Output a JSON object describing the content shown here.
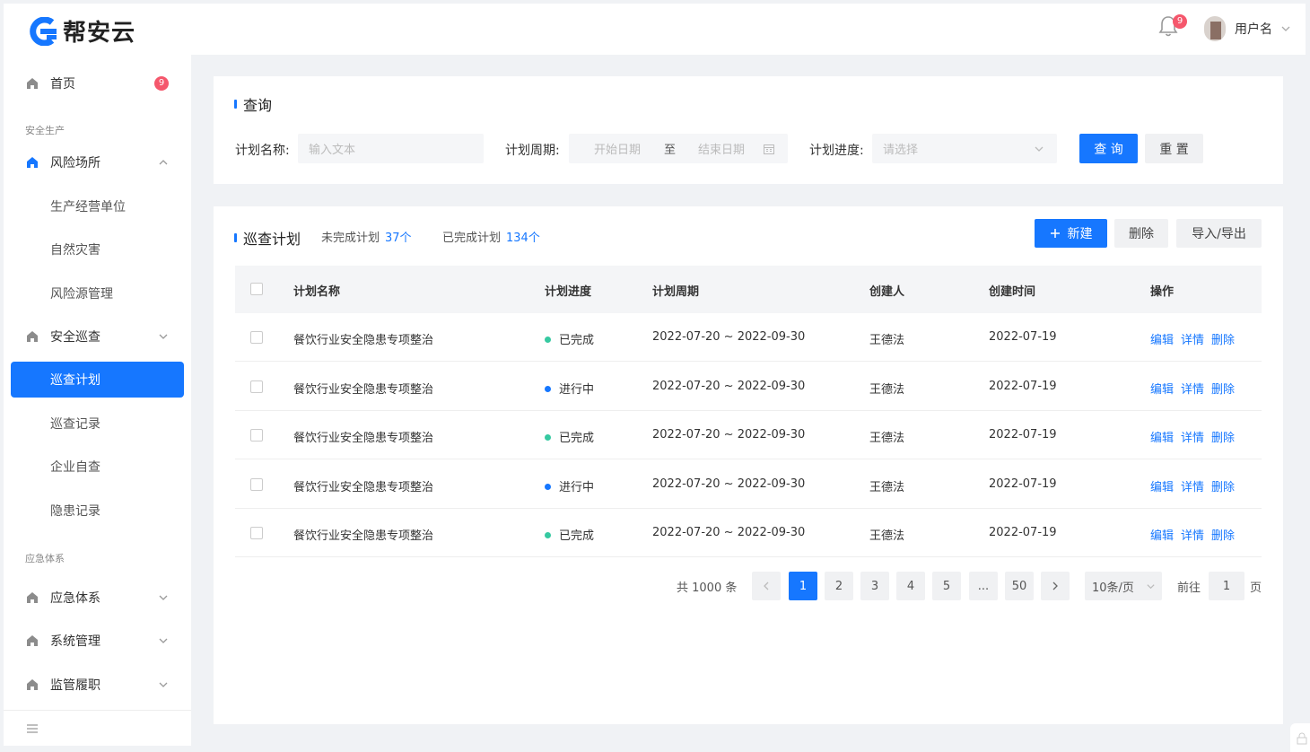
{
  "brand": {
    "name": "帮安云"
  },
  "header": {
    "notification_count": "9",
    "user_name": "用户名"
  },
  "sidebar": {
    "home": {
      "label": "首页",
      "badge": "9"
    },
    "group_safety": "安全生产",
    "risk_sites": {
      "label": "风险场所",
      "children": [
        "生产经营单位",
        "自然灾害",
        "风险源管理"
      ]
    },
    "safety_patrol": {
      "label": "安全巡查",
      "children": [
        "巡查计划",
        "巡查记录",
        "企业自查",
        "隐患记录"
      ]
    },
    "group_emergency": "应急体系",
    "emergency": {
      "label": "应急体系"
    },
    "system": {
      "label": "系统管理"
    },
    "supervision": {
      "label": "监管履职"
    }
  },
  "query": {
    "title": "查询",
    "plan_name_label": "计划名称:",
    "plan_name_placeholder": "输入文本",
    "period_label": "计划周期:",
    "start_placeholder": "开始日期",
    "range_sep": "至",
    "end_placeholder": "结束日期",
    "progress_label": "计划进度:",
    "progress_placeholder": "请选择",
    "search_btn": "查 询",
    "reset_btn": "重 置"
  },
  "plans": {
    "title": "巡查计划",
    "incomplete_label": "未完成计划",
    "incomplete_count": "37个",
    "complete_label": "已完成计划",
    "complete_count": "134个",
    "new_btn": "新建",
    "delete_btn": "删除",
    "import_export_btn": "导入/导出",
    "columns": [
      "计划名称",
      "计划进度",
      "计划周期",
      "创建人",
      "创建时间",
      "操作"
    ],
    "rows": [
      {
        "name": "餐饮行业安全隐患专项整治",
        "status": "已完成",
        "period": "2022-07-20 ~ 2022-09-30",
        "creator": "王德法",
        "created": "2022-07-19"
      },
      {
        "name": "餐饮行业安全隐患专项整治",
        "status": "进行中",
        "period": "2022-07-20 ~ 2022-09-30",
        "creator": "王德法",
        "created": "2022-07-19"
      },
      {
        "name": "餐饮行业安全隐患专项整治",
        "status": "已完成",
        "period": "2022-07-20 ~ 2022-09-30",
        "creator": "王德法",
        "created": "2022-07-19"
      },
      {
        "name": "餐饮行业安全隐患专项整治",
        "status": "进行中",
        "period": "2022-07-20 ~ 2022-09-30",
        "creator": "王德法",
        "created": "2022-07-19"
      },
      {
        "name": "餐饮行业安全隐患专项整治",
        "status": "已完成",
        "period": "2022-07-20 ~ 2022-09-30",
        "creator": "王德法",
        "created": "2022-07-19"
      }
    ],
    "actions": {
      "edit": "编辑",
      "detail": "详情",
      "delete": "删除"
    },
    "status_colors": {
      "已完成": "#36c9a1",
      "进行中": "#1677ff"
    }
  },
  "pagination": {
    "total": "共 1000 条",
    "pages": [
      "1",
      "2",
      "3",
      "4",
      "5",
      "...",
      "50"
    ],
    "current": "1",
    "page_size": "10条/页",
    "goto_label": "前往",
    "goto_value": "1",
    "page_suffix": "页"
  }
}
